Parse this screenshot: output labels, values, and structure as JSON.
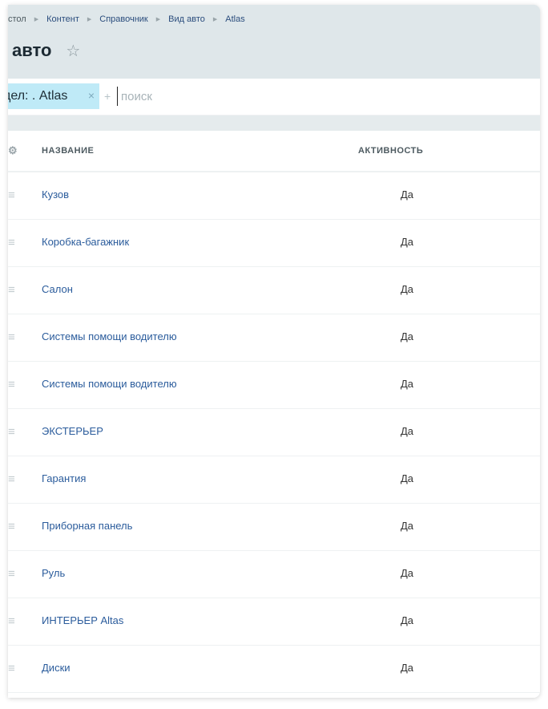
{
  "breadcrumb": [
    "стол",
    "Контент",
    "Справочник",
    "Вид авто",
    "Atlas"
  ],
  "breadcrumb_separator": "▶",
  "title": "авто",
  "star_icon": "☆",
  "filter": {
    "chip_label": "дел: . Atlas",
    "chip_remove": "×",
    "add": "+",
    "search_placeholder": "поиск"
  },
  "table": {
    "settings_icon": "⚙",
    "columns": [
      "НАЗВАНИЕ",
      "АКТИВНОСТЬ"
    ],
    "drag_icon": "≡",
    "rows": [
      {
        "name": "Кузов",
        "active": "Да"
      },
      {
        "name": "Коробка-багажник",
        "active": "Да"
      },
      {
        "name": "Салон",
        "active": "Да"
      },
      {
        "name": "Системы помощи водителю",
        "active": "Да"
      },
      {
        "name": "Системы помощи водителю",
        "active": "Да"
      },
      {
        "name": "ЭКСТЕРЬЕР",
        "active": "Да"
      },
      {
        "name": "Гарантия",
        "active": "Да"
      },
      {
        "name": "Приборная панель",
        "active": "Да"
      },
      {
        "name": "Руль",
        "active": "Да"
      },
      {
        "name": "ИНТЕРЬЕР Altas",
        "active": "Да"
      },
      {
        "name": "Диски",
        "active": "Да"
      }
    ]
  },
  "colors": {
    "header_bg": "#dfe7ea",
    "chip_bg": "#bfeaf7",
    "link": "#2b5c9c"
  }
}
